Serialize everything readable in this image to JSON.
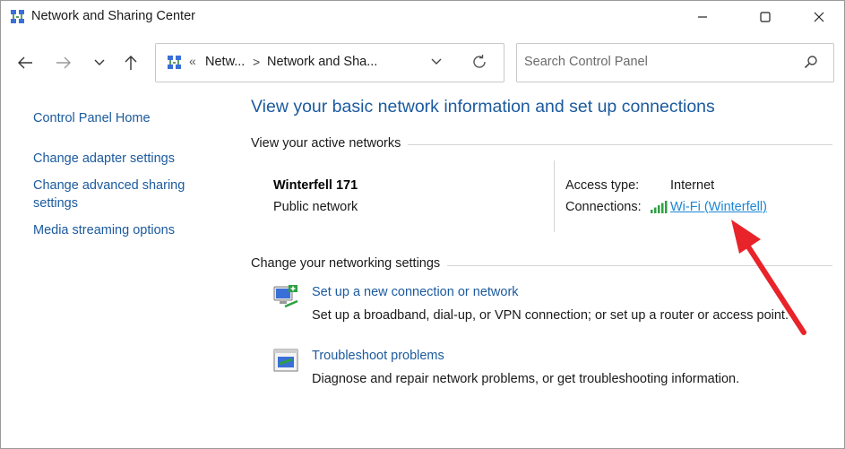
{
  "window": {
    "title": "Network and Sharing Center",
    "controls": [
      "minimize-icon",
      "maximize-icon",
      "close-icon"
    ]
  },
  "nav": {
    "back_icon": "back-arrow-icon",
    "forward_icon": "forward-arrow-icon",
    "recent_icon": "chevron-down-icon",
    "up_icon": "up-arrow-icon",
    "address": {
      "overflow": "«",
      "crumbs": [
        "Netw...",
        "Network and Sha..."
      ],
      "separator": ">",
      "refresh_icon": "refresh-icon"
    },
    "search": {
      "placeholder": "Search Control Panel",
      "icon": "search-icon"
    }
  },
  "sidebar": {
    "items": [
      {
        "label": "Control Panel Home"
      },
      {
        "label": "Change adapter settings"
      },
      {
        "label": "Change advanced sharing settings"
      },
      {
        "label": "Media streaming options"
      }
    ]
  },
  "main": {
    "heading": "View your basic network information and set up connections",
    "active_networks": {
      "title": "View your active networks",
      "network_name": "Winterfell 171",
      "network_type": "Public network",
      "access_type_label": "Access type:",
      "access_type_value": "Internet",
      "connections_label": "Connections:",
      "connection_link": "Wi-Fi (Winterfell)",
      "connection_icon": "wifi-signal-icon"
    },
    "change_settings": {
      "title": "Change your networking settings",
      "tasks": [
        {
          "icon": "new-connection-icon",
          "link": "Set up a new connection or network",
          "description": "Set up a broadband, dial-up, or VPN connection; or set up a router or access point."
        },
        {
          "icon": "troubleshoot-icon",
          "link": "Troubleshoot problems",
          "description": "Diagnose and repair network problems, or get troubleshooting information."
        }
      ]
    }
  },
  "annotation": {
    "arrow_color": "#e8232a",
    "icon": "red-arrow-annotation"
  },
  "colors": {
    "link": "#1b5a9e",
    "active_link": "#1b86d6",
    "signal": "#2ea043"
  }
}
